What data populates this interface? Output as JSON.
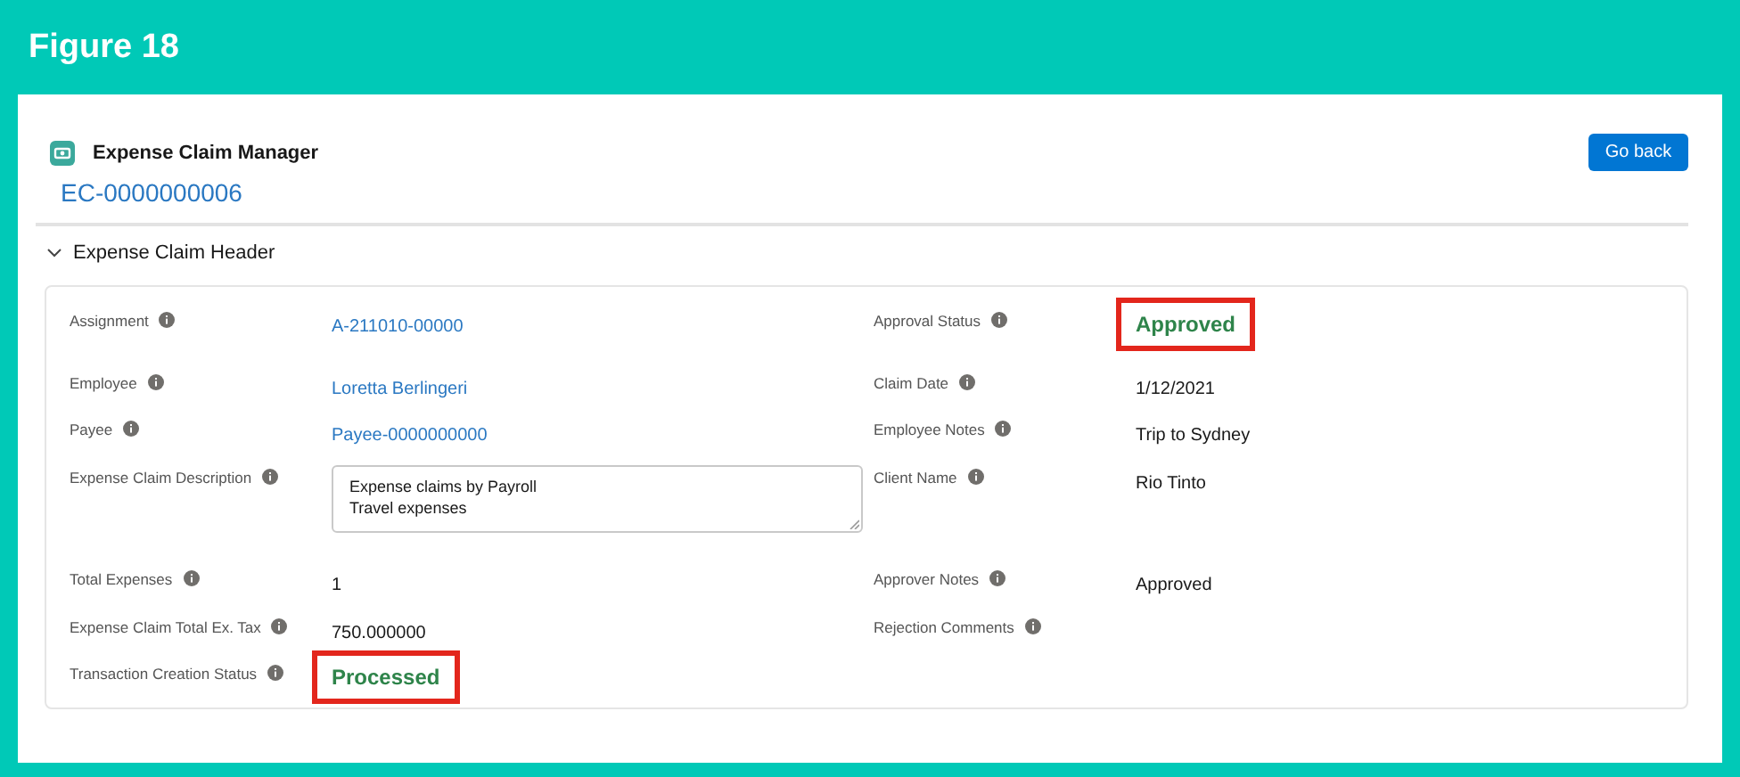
{
  "figure": {
    "title": "Figure 18"
  },
  "record": {
    "app_title": "Expense Claim Manager",
    "record_id": "EC-0000000006",
    "back_button": "Go back"
  },
  "section": {
    "title": "Expense Claim Header",
    "expanded": true
  },
  "rows": [
    {
      "left": {
        "label": "Assignment",
        "kind": "link",
        "value": "A-211010-00000"
      },
      "right": {
        "label": "Approval Status",
        "kind": "status",
        "value": "Approved",
        "highlighted": true
      }
    },
    {
      "left": {
        "label": "Employee",
        "kind": "link",
        "value": "Loretta Berlingeri"
      },
      "right": {
        "label": "Claim Date",
        "kind": "text",
        "value": "1/12/2021"
      }
    },
    {
      "left": {
        "label": "Payee",
        "kind": "link",
        "value": "Payee-0000000000"
      },
      "right": {
        "label": "Employee Notes",
        "kind": "text",
        "value": "Trip to Sydney"
      }
    },
    {
      "left": {
        "label": "Expense Claim Description",
        "kind": "textarea",
        "lines": [
          "Expense claims by Payroll",
          "Travel expenses"
        ]
      },
      "right": {
        "label": "Client Name",
        "kind": "text",
        "value": "Rio Tinto"
      }
    },
    {
      "left": {
        "label": "Total Expenses",
        "kind": "text",
        "value": "1"
      },
      "right": {
        "label": "Approver Notes",
        "kind": "text",
        "value": "Approved"
      }
    },
    {
      "left": {
        "label": "Expense Claim Total Ex. Tax",
        "kind": "text",
        "value": "750.000000"
      },
      "right": {
        "label": "Rejection Comments",
        "kind": "empty"
      }
    },
    {
      "left": {
        "label": "Transaction Creation Status",
        "kind": "status",
        "value": "Processed",
        "highlighted": true
      }
    }
  ]
}
